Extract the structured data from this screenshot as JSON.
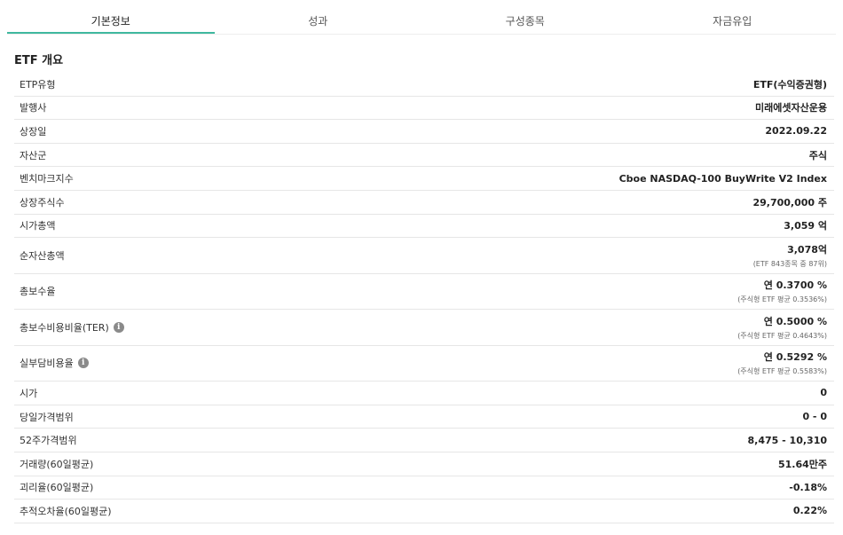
{
  "tabs": [
    "기본정보",
    "성과",
    "구성종목",
    "자금유입"
  ],
  "section_title": "ETF 개요",
  "rows": [
    {
      "label": "ETP유형",
      "value": "ETF(수익증권형)",
      "sub": ""
    },
    {
      "label": "발행사",
      "value": "미래에셋자산운용",
      "sub": ""
    },
    {
      "label": "상장일",
      "value": "2022.09.22",
      "sub": ""
    },
    {
      "label": "자산군",
      "value": "주식",
      "sub": ""
    },
    {
      "label": "벤치마크지수",
      "value": "Cboe NASDAQ-100 BuyWrite V2 Index",
      "sub": ""
    },
    {
      "label": "상장주식수",
      "value": "29,700,000 주",
      "sub": ""
    },
    {
      "label": "시가총액",
      "value": "3,059 억",
      "sub": ""
    },
    {
      "label": "순자산총액",
      "value": "3,078억",
      "sub": "(ETF 843종목 중 87위)"
    },
    {
      "label": "총보수율",
      "value": "연 0.3700 %",
      "sub": "(주식형 ETF 평균 0.3536%)"
    },
    {
      "label": "총보수비용비율(TER)",
      "value": "연 0.5000 %",
      "sub": "(주식형 ETF 평균 0.4643%)"
    },
    {
      "label": "실부담비용율",
      "value": "연 0.5292 %",
      "sub": "(주식형 ETF 평균 0.5583%)"
    },
    {
      "label": "시가",
      "value": "0",
      "sub": ""
    },
    {
      "label": "당일가격범위",
      "value": "0 - 0",
      "sub": ""
    },
    {
      "label": "52주가격범위",
      "value": "8,475 - 10,310",
      "sub": ""
    },
    {
      "label": "거래량(60일평균)",
      "value": "51.64만주",
      "sub": ""
    },
    {
      "label": "괴리율(60일평균)",
      "value": "-0.18%",
      "sub": ""
    },
    {
      "label": "추적오차율(60일평균)",
      "value": "0.22%",
      "sub": ""
    }
  ],
  "icons": {
    "info": "info-icon"
  },
  "colors": {
    "active_tab_underline": "#3fb89f",
    "row_divider": "#e6e6e6"
  }
}
